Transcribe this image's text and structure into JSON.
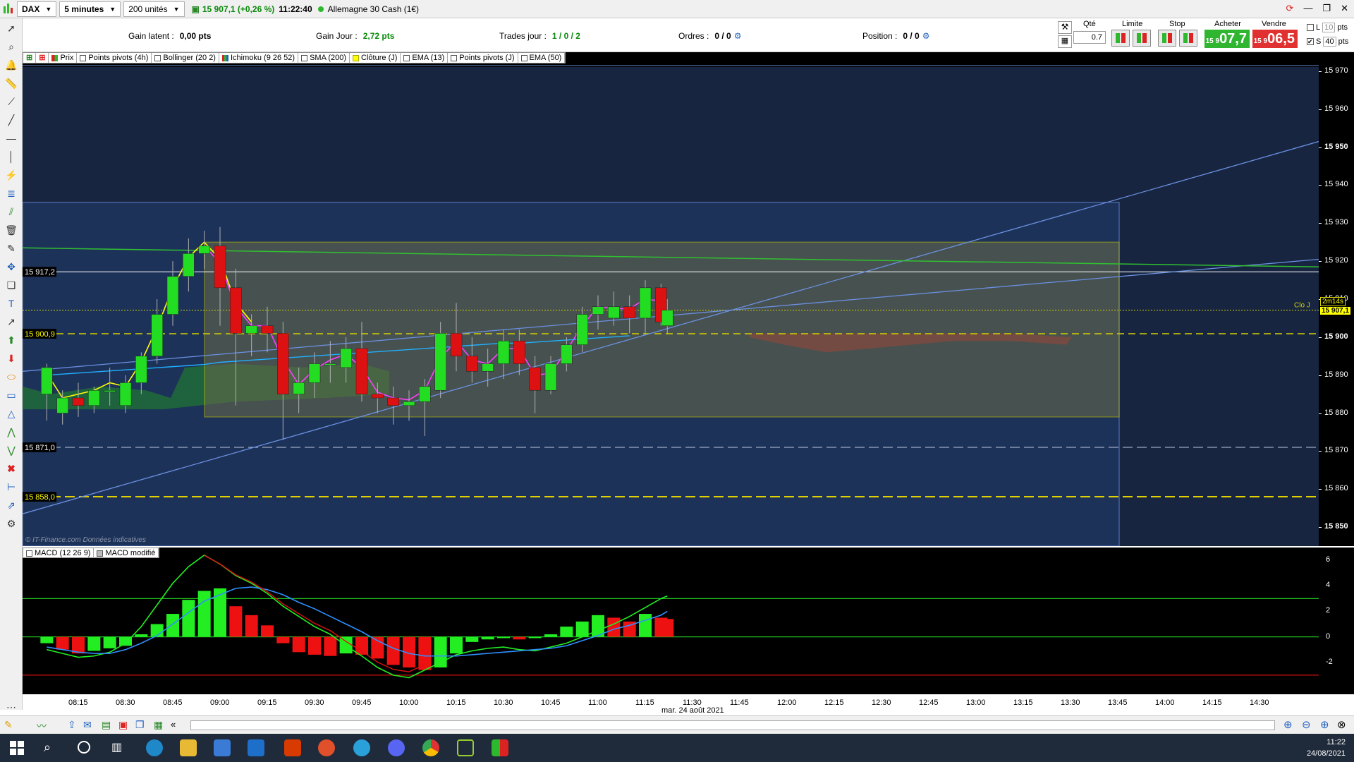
{
  "topbar": {
    "symbol": "DAX",
    "timeframe": "5 minutes",
    "units": "200 unités",
    "price_change": "15 907,1 (+0,26 %)",
    "time": "11:22:40",
    "instrument": "Allemagne 30 Cash (1€)"
  },
  "orderbar": {
    "gain_latent_label": "Gain latent :",
    "gain_latent_value": "0,00 pts",
    "gain_jour_label": "Gain Jour :",
    "gain_jour_value": "2,72 pts",
    "trades_label": "Trades jour :",
    "trades_value": "1 / 0 / 2",
    "ordres_label": "Ordres :",
    "ordres_value": "0 / 0",
    "position_label": "Position :",
    "position_value": "0 / 0",
    "qty_label": "Qté",
    "qty_value": "0.7",
    "limit_label": "Limite",
    "stop_label": "Stop",
    "buy_label": "Acheter",
    "sell_label": "Vendre",
    "buy_small": "15 9",
    "buy_big": "07,7",
    "sell_small": "15 9",
    "sell_big": "06,5",
    "l_label": "L",
    "l_value": "10",
    "pts_label": "pts",
    "s_label": "S",
    "s_value": "40",
    "pts_label2": "pts"
  },
  "legend": [
    {
      "label": "Prix"
    },
    {
      "label": "Points pivots (4h)"
    },
    {
      "label": "Bollinger (20 2)"
    },
    {
      "label": "Ichimoku (9 26 52)"
    },
    {
      "label": "SMA (200)"
    },
    {
      "label": "Clôture (J)"
    },
    {
      "label": "EMA (13)"
    },
    {
      "label": "Points pivots (J)"
    },
    {
      "label": "EMA (50)"
    }
  ],
  "price_axis": [
    {
      "label": "15 970",
      "bold": false
    },
    {
      "label": "15 960",
      "bold": false
    },
    {
      "label": "15 950",
      "bold": true
    },
    {
      "label": "15 940",
      "bold": false
    },
    {
      "label": "15 930",
      "bold": false
    },
    {
      "label": "15 920",
      "bold": false
    },
    {
      "label": "15 910",
      "bold": false
    },
    {
      "label": "15 900",
      "bold": true
    },
    {
      "label": "15 890",
      "bold": false
    },
    {
      "label": "15 880",
      "bold": false
    },
    {
      "label": "15 870",
      "bold": false
    },
    {
      "label": "15 860",
      "bold": false
    },
    {
      "label": "15 850",
      "bold": true
    }
  ],
  "price_tags": {
    "current": "15 907,1",
    "timer": "2m14s",
    "clo_j": "Clo J",
    "level1": "15 917,2",
    "level2": "15 900,9",
    "level3": "15 871,0",
    "level4": "15 858,0"
  },
  "watermark": "© IT-Finance.com  Données indicatives",
  "macd_legend": [
    {
      "label": "MACD (12 26 9)"
    },
    {
      "label": "MACD modifié"
    }
  ],
  "macd_axis": [
    "6",
    "4",
    "2",
    "0",
    "-2"
  ],
  "time_axis": [
    "08:15",
    "08:30",
    "08:45",
    "09:00",
    "09:15",
    "09:30",
    "09:45",
    "10:00",
    "10:15",
    "10:30",
    "10:45",
    "11:00",
    "11:15",
    "11:30",
    "11:45",
    "12:00",
    "12:15",
    "12:30",
    "12:45",
    "13:00",
    "13:15",
    "13:30",
    "13:45",
    "14:00",
    "14:15",
    "14:30"
  ],
  "date_label": "mar. 24 août 2021",
  "clock": {
    "time": "11:22",
    "date": "24/08/2021"
  },
  "chart_data": {
    "type": "candlestick",
    "ylim": [
      15845,
      15975
    ],
    "candles": [
      {
        "t": "08:05",
        "o": 15885,
        "h": 15893,
        "l": 15878,
        "c": 15892
      },
      {
        "t": "08:10",
        "o": 15880,
        "h": 15886,
        "l": 15877,
        "c": 15884
      },
      {
        "t": "08:15",
        "o": 15884,
        "h": 15888,
        "l": 15879,
        "c": 15882
      },
      {
        "t": "08:20",
        "o": 15882,
        "h": 15887,
        "l": 15880,
        "c": 15886
      },
      {
        "t": "08:25",
        "o": 15886,
        "h": 15892,
        "l": 15882,
        "c": 15886
      },
      {
        "t": "08:30",
        "o": 15882,
        "h": 15890,
        "l": 15880,
        "c": 15888
      },
      {
        "t": "08:35",
        "o": 15888,
        "h": 15896,
        "l": 15885,
        "c": 15895
      },
      {
        "t": "08:40",
        "o": 15895,
        "h": 15910,
        "l": 15893,
        "c": 15906
      },
      {
        "t": "08:45",
        "o": 15906,
        "h": 15920,
        "l": 15903,
        "c": 15916
      },
      {
        "t": "08:50",
        "o": 15916,
        "h": 15926,
        "l": 15912,
        "c": 15922
      },
      {
        "t": "08:55",
        "o": 15922,
        "h": 15928,
        "l": 15918,
        "c": 15924
      },
      {
        "t": "09:00",
        "o": 15924,
        "h": 15929,
        "l": 15903,
        "c": 15913
      },
      {
        "t": "09:05",
        "o": 15913,
        "h": 15918,
        "l": 15882,
        "c": 15901
      },
      {
        "t": "09:10",
        "o": 15901,
        "h": 15906,
        "l": 15895,
        "c": 15903
      },
      {
        "t": "09:15",
        "o": 15903,
        "h": 15908,
        "l": 15896,
        "c": 15901
      },
      {
        "t": "09:20",
        "o": 15901,
        "h": 15904,
        "l": 15873,
        "c": 15885
      },
      {
        "t": "09:25",
        "o": 15885,
        "h": 15892,
        "l": 15880,
        "c": 15888
      },
      {
        "t": "09:30",
        "o": 15888,
        "h": 15896,
        "l": 15884,
        "c": 15893
      },
      {
        "t": "09:35",
        "o": 15893,
        "h": 15899,
        "l": 15888,
        "c": 15893
      },
      {
        "t": "09:40",
        "o": 15892,
        "h": 15900,
        "l": 15888,
        "c": 15897
      },
      {
        "t": "09:45",
        "o": 15897,
        "h": 15904,
        "l": 15883,
        "c": 15885
      },
      {
        "t": "09:50",
        "o": 15885,
        "h": 15888,
        "l": 15880,
        "c": 15884
      },
      {
        "t": "09:55",
        "o": 15884,
        "h": 15887,
        "l": 15877,
        "c": 15882
      },
      {
        "t": "10:00",
        "o": 15882,
        "h": 15886,
        "l": 15878,
        "c": 15883
      },
      {
        "t": "10:05",
        "o": 15883,
        "h": 15889,
        "l": 15874,
        "c": 15887
      },
      {
        "t": "10:10",
        "o": 15886,
        "h": 15904,
        "l": 15884,
        "c": 15901
      },
      {
        "t": "10:15",
        "o": 15901,
        "h": 15909,
        "l": 15891,
        "c": 15895
      },
      {
        "t": "10:20",
        "o": 15895,
        "h": 15900,
        "l": 15888,
        "c": 15891
      },
      {
        "t": "10:25",
        "o": 15891,
        "h": 15897,
        "l": 15887,
        "c": 15893
      },
      {
        "t": "10:30",
        "o": 15893,
        "h": 15902,
        "l": 15889,
        "c": 15899
      },
      {
        "t": "10:35",
        "o": 15899,
        "h": 15902,
        "l": 15890,
        "c": 15893
      },
      {
        "t": "10:40",
        "o": 15892,
        "h": 15895,
        "l": 15880,
        "c": 15886
      },
      {
        "t": "10:45",
        "o": 15886,
        "h": 15895,
        "l": 15885,
        "c": 15893
      },
      {
        "t": "10:50",
        "o": 15893,
        "h": 15900,
        "l": 15891,
        "c": 15898
      },
      {
        "t": "10:55",
        "o": 15898,
        "h": 15908,
        "l": 15896,
        "c": 15906
      },
      {
        "t": "11:00",
        "o": 15906,
        "h": 15911,
        "l": 15902,
        "c": 15908
      },
      {
        "t": "11:05",
        "o": 15905,
        "h": 15912,
        "l": 15903,
        "c": 15908
      },
      {
        "t": "11:10",
        "o": 15908,
        "h": 15911,
        "l": 15901,
        "c": 15905
      },
      {
        "t": "11:15",
        "o": 15905,
        "h": 15915,
        "l": 15901,
        "c": 15913
      },
      {
        "t": "11:20",
        "o": 15913,
        "h": 15914,
        "l": 15903,
        "c": 15904
      },
      {
        "t": "11:22",
        "o": 15903,
        "h": 15910,
        "l": 15901,
        "c": 15907.1
      }
    ],
    "macd_ylim": [
      -4.5,
      7
    ],
    "macd_hist": [
      -0.5,
      -1.0,
      -1.3,
      -1.1,
      -0.9,
      -0.7,
      0.2,
      1.0,
      1.8,
      2.9,
      3.6,
      3.8,
      2.4,
      1.7,
      0.9,
      -0.5,
      -1.2,
      -1.4,
      -1.5,
      -1.3,
      -1.4,
      -1.7,
      -2.2,
      -2.4,
      -2.6,
      -2.4,
      -1.3,
      -0.4,
      -0.2,
      -0.1,
      -0.2,
      -0.1,
      0.2,
      0.8,
      1.2,
      1.7,
      1.5,
      1.2,
      1.8,
      1.5,
      1.4
    ],
    "macd_line": [
      -1.0,
      -1.3,
      -1.6,
      -1.5,
      -1.2,
      -0.5,
      0.8,
      2.5,
      4.2,
      5.5,
      6.4,
      5.7,
      4.8,
      4.2,
      3.4,
      2.4,
      1.6,
      0.8,
      0.2,
      -0.7,
      -1.5,
      -2.4,
      -3.0,
      -3.2,
      -2.6,
      -2.0,
      -1.4,
      -1.1,
      -0.9,
      -0.8,
      -1.0,
      -1.1,
      -0.8,
      -0.5,
      0.0,
      0.5,
      1.0,
      1.6,
      2.3,
      3.0,
      3.2
    ],
    "signal_line": [
      -0.8,
      -1.0,
      -1.2,
      -1.3,
      -1.3,
      -1.0,
      -0.5,
      0.1,
      1.0,
      1.9,
      2.8,
      3.3,
      3.8,
      3.9,
      3.7,
      3.3,
      2.7,
      2.2,
      1.6,
      1.0,
      0.4,
      -0.3,
      -0.9,
      -1.3,
      -1.5,
      -1.5,
      -1.5,
      -1.4,
      -1.3,
      -1.2,
      -1.1,
      -1.0,
      -0.9,
      -0.7,
      -0.3,
      0.1,
      0.6,
      0.9,
      1.3,
      1.7,
      2.0
    ],
    "macd_levels": [
      3,
      0,
      -3
    ]
  }
}
